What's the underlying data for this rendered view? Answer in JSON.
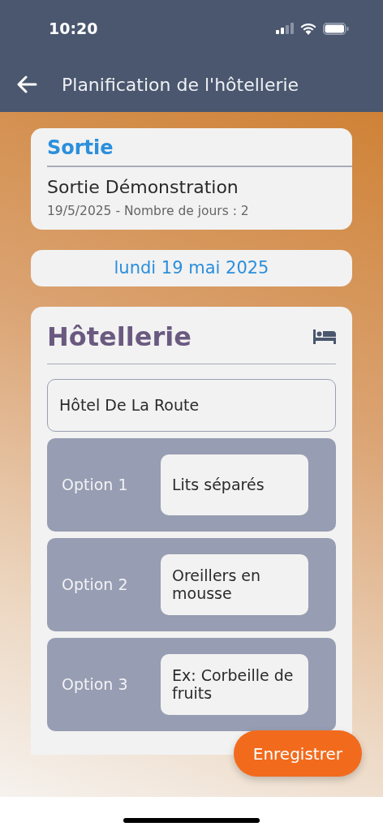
{
  "status_bar": {
    "time": "10:20"
  },
  "app_bar": {
    "title": "Planification de l'hôtellerie"
  },
  "outing": {
    "heading": "Sortie",
    "name": "Sortie Démonstration",
    "details": "19/5/2025 - Nombre de jours : 2"
  },
  "date": "lundi 19 mai 2025",
  "hotel_section": {
    "title": "Hôtellerie",
    "hotel_name": "Hôtel De La Route",
    "options": [
      {
        "label": "Option 1",
        "value": "Lits séparés"
      },
      {
        "label": "Option 2",
        "value": "Oreillers en mousse"
      },
      {
        "label": "Option 3",
        "value": "Ex: Corbeille de fruits"
      }
    ]
  },
  "save_button": "Enregistrer"
}
